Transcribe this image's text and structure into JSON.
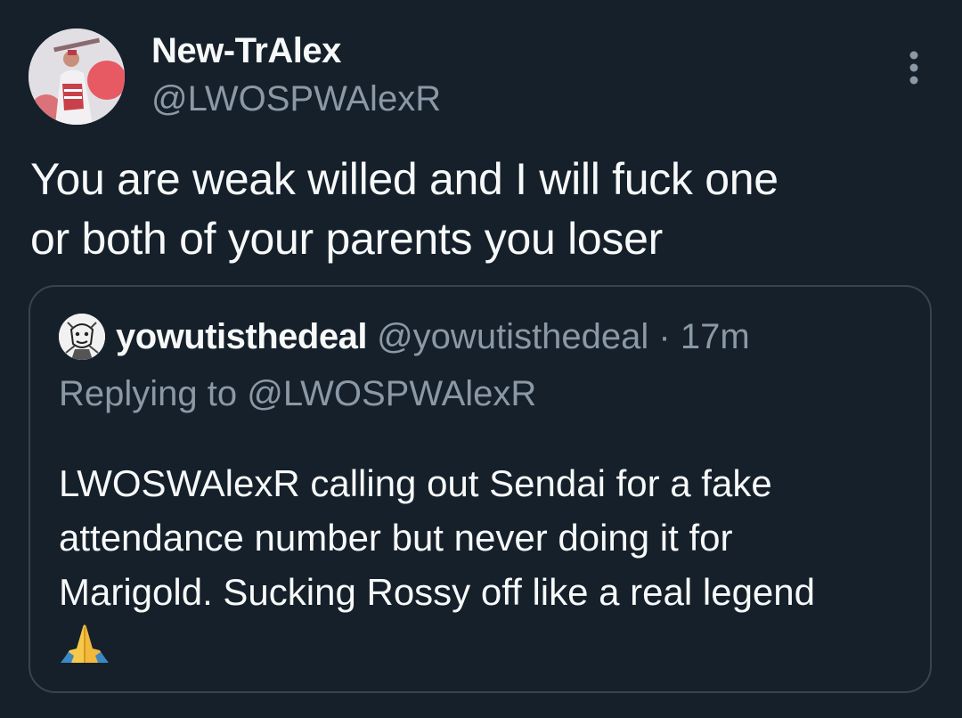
{
  "author": {
    "display_name": "New-TrAlex",
    "handle": "@LWOSPWAlexR",
    "avatar_icon": "profile-photo-avatar"
  },
  "menu": {
    "icon": "more-vertical-icon"
  },
  "tweet": {
    "text_line1": "You are weak willed and I will fuck one",
    "text_line2": "or both of your parents you loser"
  },
  "quoted_tweet": {
    "display_name": "yowutisthedeal",
    "handle": "@yowutisthedeal",
    "separator": "·",
    "time": "17m",
    "replying_to": "Replying to @LWOSPWAlexR",
    "text_line1": "LWOSWAlexR calling out Sendai for a fake",
    "text_line2": "attendance number but never doing it for",
    "text_line3": "Marigold. Sucking Rossy off like a real legend",
    "emoji_icon": "folded-hands-emoji"
  },
  "colors": {
    "background": "#15202b",
    "primary_text": "#f7f9f9",
    "secondary_text": "#8b98a5",
    "border": "#38444d"
  }
}
